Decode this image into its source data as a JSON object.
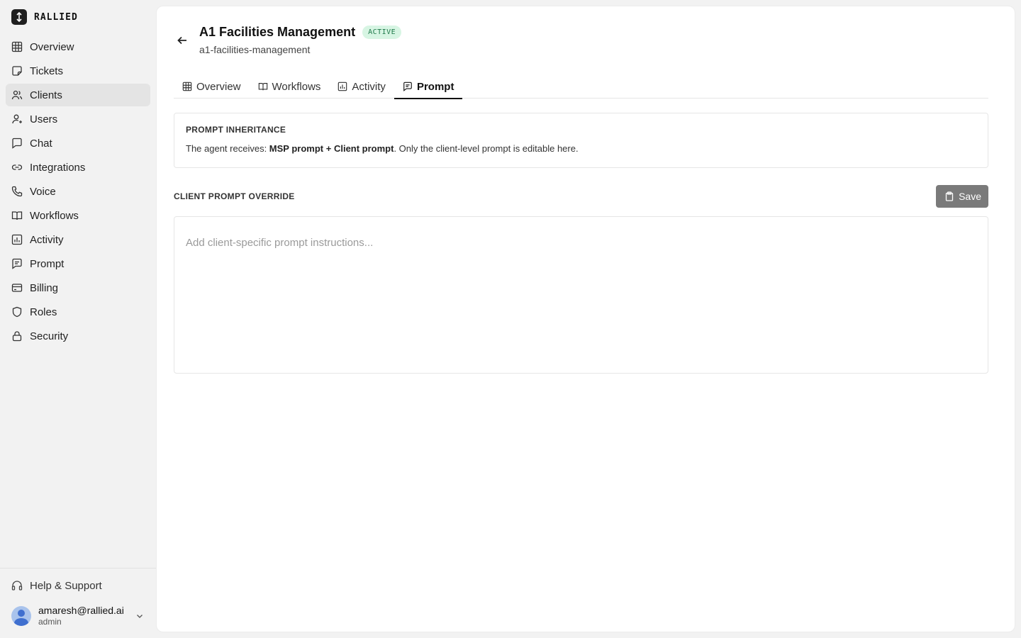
{
  "brand": {
    "name": "RALLIED"
  },
  "sidebar": {
    "items": [
      {
        "label": "Overview",
        "icon": "grid-icon"
      },
      {
        "label": "Tickets",
        "icon": "ticket-icon"
      },
      {
        "label": "Clients",
        "icon": "users-icon",
        "active": true
      },
      {
        "label": "Users",
        "icon": "user-icon"
      },
      {
        "label": "Chat",
        "icon": "chat-icon"
      },
      {
        "label": "Integrations",
        "icon": "link-icon"
      },
      {
        "label": "Voice",
        "icon": "phone-icon"
      },
      {
        "label": "Workflows",
        "icon": "book-icon"
      },
      {
        "label": "Activity",
        "icon": "chart-icon"
      },
      {
        "label": "Prompt",
        "icon": "message-icon"
      },
      {
        "label": "Billing",
        "icon": "card-icon"
      },
      {
        "label": "Roles",
        "icon": "shield-icon"
      },
      {
        "label": "Security",
        "icon": "lock-icon"
      }
    ],
    "help": {
      "label": "Help & Support",
      "icon": "headphones-icon"
    },
    "user": {
      "email": "amaresh@rallied.ai",
      "role": "admin"
    }
  },
  "header": {
    "title": "A1 Facilities Management",
    "status": "ACTIVE",
    "slug": "a1-facilities-management"
  },
  "tabs": [
    {
      "label": "Overview",
      "icon": "grid-icon"
    },
    {
      "label": "Workflows",
      "icon": "book-icon"
    },
    {
      "label": "Activity",
      "icon": "chart-icon"
    },
    {
      "label": "Prompt",
      "icon": "message-icon",
      "active": true
    }
  ],
  "inheritance": {
    "label": "PROMPT INHERITANCE",
    "prefix": "The agent receives: ",
    "msp": "MSP prompt",
    "plus": " + ",
    "client": "Client prompt",
    "suffix": ". Only the client-level prompt is editable here."
  },
  "override": {
    "label": "CLIENT PROMPT OVERRIDE",
    "save_label": "Save",
    "value": "",
    "placeholder": "Add client-specific prompt instructions..."
  },
  "colors": {
    "badge_bg": "#d7f5e3",
    "badge_text": "#1f7a4a",
    "save_bg": "#7a7a7a",
    "active_nav_bg": "#e4e4e4"
  }
}
